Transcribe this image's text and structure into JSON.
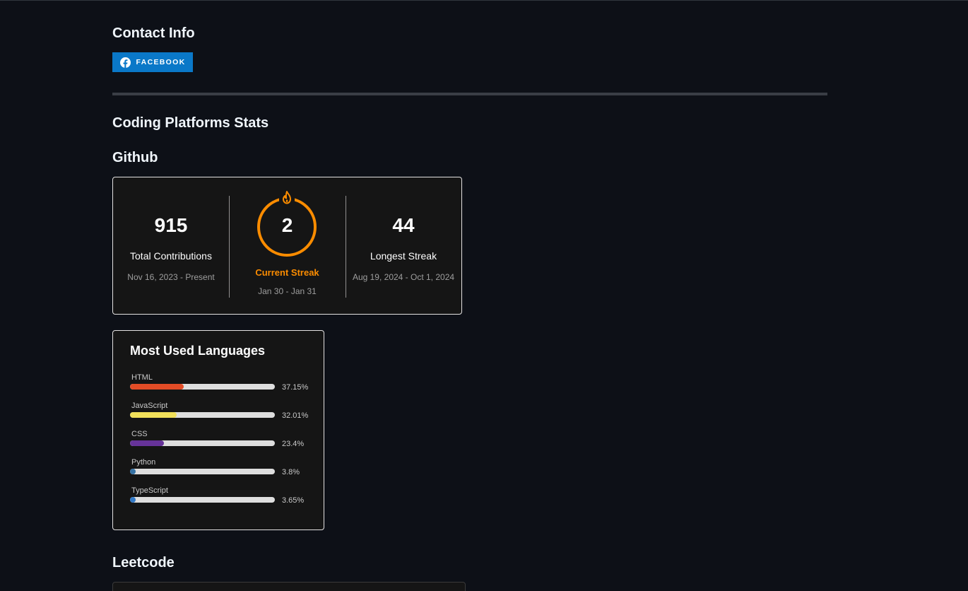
{
  "contact": {
    "heading": "Contact Info",
    "facebook_label": "FACEBOOK",
    "facebook_icon": "facebook-icon",
    "facebook_color": "#0a78c8"
  },
  "coding": {
    "heading": "Coding Platforms Stats",
    "github_heading": "Github",
    "leetcode_heading": "Leetcode"
  },
  "streak": {
    "total": {
      "value": "915",
      "label": "Total Contributions",
      "range": "Nov 16, 2023 - Present"
    },
    "current": {
      "value": "2",
      "label": "Current Streak",
      "range": "Jan 30 - Jan 31",
      "icon": "fire-icon",
      "color": "#fb8c00"
    },
    "longest": {
      "value": "44",
      "label": "Longest Streak",
      "range": "Aug 19, 2024 - Oct 1, 2024"
    }
  },
  "languages": {
    "title": "Most Used Languages",
    "items": [
      {
        "name": "HTML",
        "percent": 37.15,
        "percent_label": "37.15%",
        "color": "#e34c26"
      },
      {
        "name": "JavaScript",
        "percent": 32.01,
        "percent_label": "32.01%",
        "color": "#f1e05a"
      },
      {
        "name": "CSS",
        "percent": 23.4,
        "percent_label": "23.4%",
        "color": "#663399"
      },
      {
        "name": "Python",
        "percent": 3.8,
        "percent_label": "3.8%",
        "color": "#3572a5"
      },
      {
        "name": "TypeScript",
        "percent": 3.65,
        "percent_label": "3.65%",
        "color": "#3178c6"
      }
    ]
  }
}
